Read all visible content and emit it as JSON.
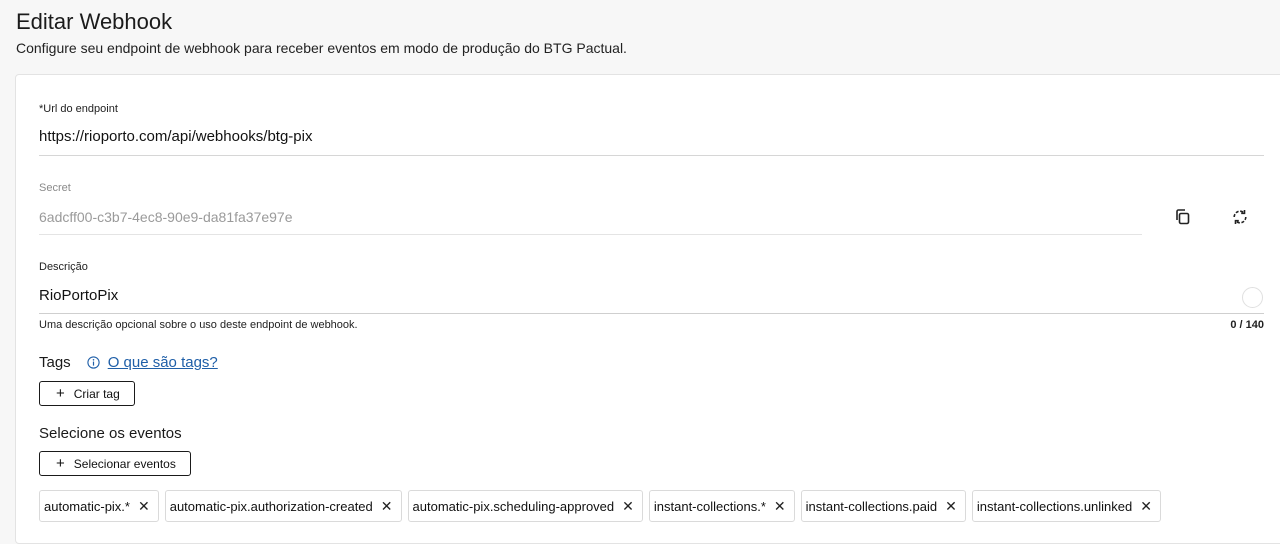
{
  "header": {
    "title": "Editar Webhook",
    "subtitle": "Configure seu endpoint de webhook para receber eventos em modo de produção do BTG Pactual."
  },
  "url_field": {
    "label": "*Url do endpoint",
    "value": "https://rioporto.com/api/webhooks/btg-pix"
  },
  "secret_field": {
    "label": "Secret",
    "value": "6adcff00-c3b7-4ec8-90e9-da81fa37e97e",
    "copy_icon": "copy-icon",
    "regenerate_icon": "refresh-icon"
  },
  "description_field": {
    "label": "Descrição",
    "value": "RioPortoPix",
    "helper": "Uma descrição opcional sobre o uso deste endpoint de webhook.",
    "counter": "0 / 140"
  },
  "tags": {
    "title": "Tags",
    "info_icon": "info-icon",
    "help_link": "O que são tags?",
    "create_button": "Criar tag"
  },
  "events": {
    "title": "Selecione os eventos",
    "select_button": "Selecionar eventos",
    "selected": [
      "automatic-pix.*",
      "automatic-pix.authorization-created",
      "automatic-pix.scheduling-approved",
      "instant-collections.*",
      "instant-collections.paid",
      "instant-collections.unlinked"
    ]
  },
  "colors": {
    "link": "#1f5fa8",
    "border": "#dadada",
    "background": "#f7f7f7"
  }
}
